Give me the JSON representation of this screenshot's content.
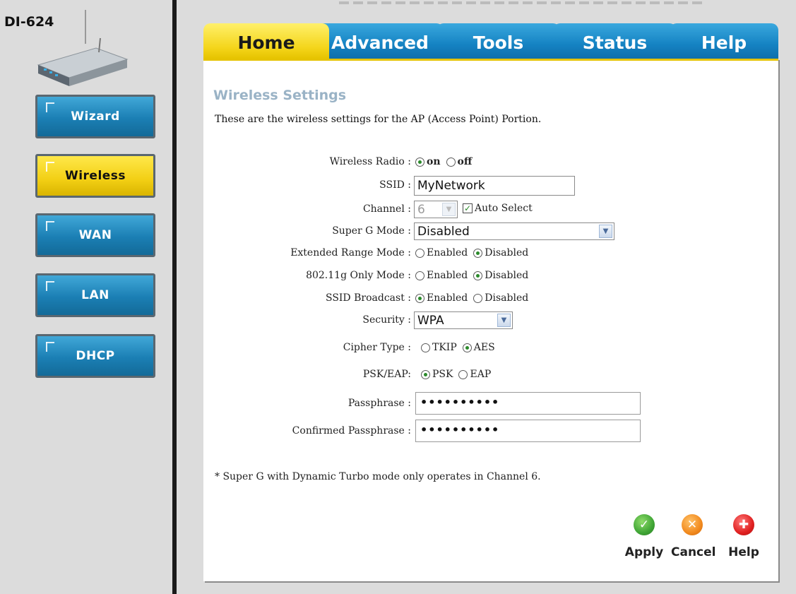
{
  "device": {
    "model": "DI-624"
  },
  "sidebar": {
    "items": [
      {
        "label": "Wizard",
        "active": false
      },
      {
        "label": "Wireless",
        "active": true
      },
      {
        "label": "WAN",
        "active": false
      },
      {
        "label": "LAN",
        "active": false
      },
      {
        "label": "DHCP",
        "active": false
      }
    ]
  },
  "tabs": [
    {
      "label": "Home",
      "active": true
    },
    {
      "label": "Advanced",
      "active": false
    },
    {
      "label": "Tools",
      "active": false
    },
    {
      "label": "Status",
      "active": false
    },
    {
      "label": "Help",
      "active": false
    }
  ],
  "page": {
    "title": "Wireless Settings",
    "description": "These are the wireless settings for the AP (Access Point) Portion."
  },
  "form": {
    "wireless_radio": {
      "label": "Wireless Radio :",
      "opt_on": "on",
      "opt_off": "off",
      "selected": "on"
    },
    "ssid": {
      "label": "SSID :",
      "value": "MyNetwork"
    },
    "channel": {
      "label": "Channel :",
      "value": "6",
      "auto_label": "Auto Select",
      "auto_checked": true
    },
    "super_g": {
      "label": "Super G Mode :",
      "value": "Disabled"
    },
    "extended_range": {
      "label": "Extended Range Mode :",
      "opt_a": "Enabled",
      "opt_b": "Disabled",
      "selected": "Disabled"
    },
    "g_only": {
      "label": "802.11g Only Mode :",
      "opt_a": "Enabled",
      "opt_b": "Disabled",
      "selected": "Disabled"
    },
    "ssid_broadcast": {
      "label": "SSID Broadcast :",
      "opt_a": "Enabled",
      "opt_b": "Disabled",
      "selected": "Enabled"
    },
    "security": {
      "label": "Security :",
      "value": "WPA"
    },
    "cipher": {
      "label": "Cipher Type :",
      "opt_a": "TKIP",
      "opt_b": "AES",
      "selected": "AES"
    },
    "psk_eap": {
      "label": "PSK/EAP:",
      "opt_a": "PSK",
      "opt_b": "EAP",
      "selected": "PSK"
    },
    "passphrase": {
      "label": "Passphrase :",
      "value": "••••••••••"
    },
    "confirm": {
      "label": "Confirmed Passphrase :",
      "value": "••••••••••"
    }
  },
  "footnote": "* Super G with Dynamic Turbo mode only operates in Channel 6.",
  "actions": {
    "apply": {
      "label": "Apply",
      "color": "#3fa535"
    },
    "cancel": {
      "label": "Cancel",
      "color": "#f28a1e"
    },
    "help": {
      "label": "Help",
      "color": "#e02020"
    }
  },
  "colors": {
    "tab_active": "#f4d51a",
    "tab_inactive": "#1583c3",
    "title": "#9ab3c6",
    "radio_dot": "#2a8a2a"
  }
}
